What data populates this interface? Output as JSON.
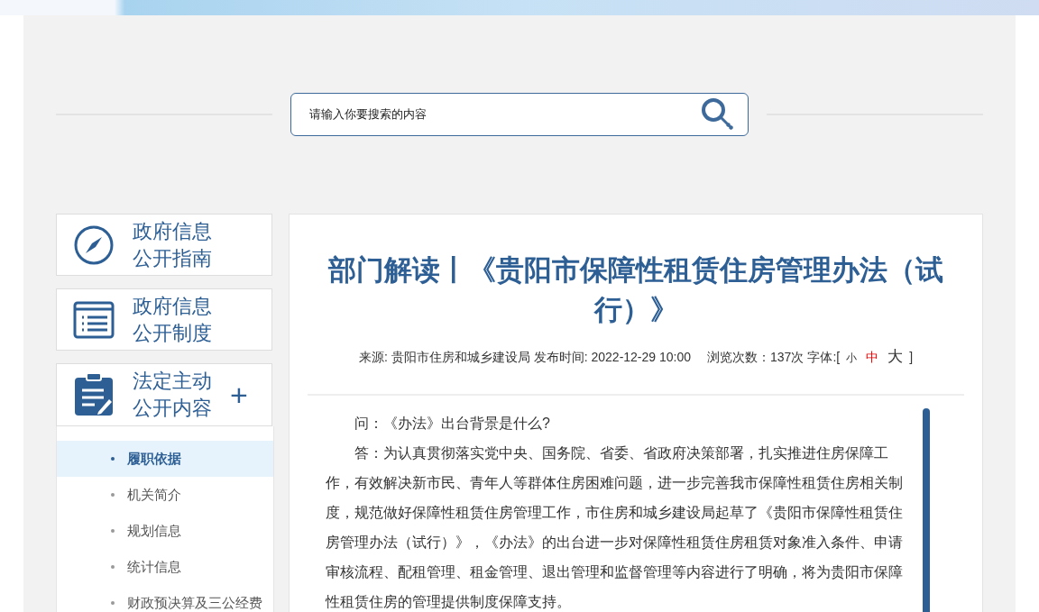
{
  "search": {
    "placeholder": "请输入你要搜索的内容"
  },
  "sidebar": {
    "cards": [
      {
        "kind": "compass",
        "line1": "政府信息",
        "line2": "公开指南"
      },
      {
        "kind": "list",
        "line1": "政府信息",
        "line2": "公开制度"
      },
      {
        "kind": "clipboard",
        "line1": "法定主动",
        "line2": "公开内容",
        "toggle": "+"
      }
    ],
    "items": [
      {
        "label": "履职依据",
        "selected": true
      },
      {
        "label": "机关简介",
        "selected": false
      },
      {
        "label": "规划信息",
        "selected": false
      },
      {
        "label": "统计信息",
        "selected": false
      },
      {
        "label": "财政预决算及三公经费",
        "selected": false
      }
    ]
  },
  "article": {
    "title": "部门解读丨《贵阳市保障性租赁住房管理办法（试行）》",
    "source": "来源: 贵阳市住房和城乡建设局",
    "published": "发布时间: 2022-12-29 10:00",
    "views": "浏览次数：137次",
    "font_label": "字体:[",
    "font_sizes": [
      {
        "label": "小",
        "kind": "small",
        "selected": false
      },
      {
        "label": "中",
        "kind": "medium",
        "selected": true
      },
      {
        "label": "大",
        "kind": "large",
        "selected": false
      }
    ],
    "font_close": "]",
    "paragraphs": [
      "问：《办法》出台背景是什么?",
      "答：为认真贯彻落实党中央、国务院、省委、省政府决策部署，扎实推进住房保障工作，有效解决新市民、青年人等群体住房困难问题，进一步完善我市保障性租赁住房相关制度，规范做好保障性租赁住房管理工作，市住房和城乡建设局起草了《贵阳市保障性租赁住房管理办法（试行）》，《办法》的出台进一步对保障性租赁住房租赁对象准入条件、申请审核流程、配租管理、租金管理、退出管理和监督管理等内容进行了明确，将为贵阳市保障性租赁住房的管理提供制度保障支持。"
    ]
  }
}
